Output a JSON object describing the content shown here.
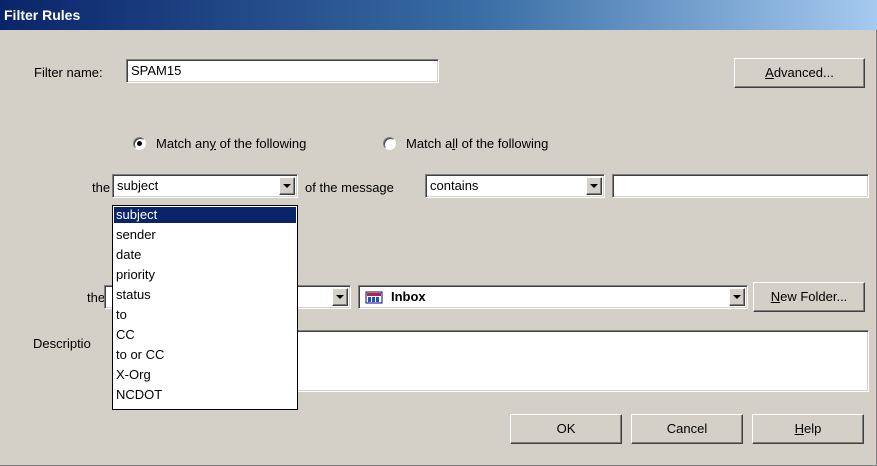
{
  "window": {
    "title": "Filter Rules"
  },
  "filter_name": {
    "label": "Filter name:",
    "value": "SPAM15"
  },
  "advanced_button": {
    "prefix": "",
    "accel": "A",
    "rest": "dvanced..."
  },
  "match": {
    "any_pre": "Match an",
    "any_accel": "y",
    "any_post": " of the following",
    "all_pre": "Match a",
    "all_accel": "l",
    "all_post": "l of the following",
    "selected": "any"
  },
  "condition": {
    "the_label": "the",
    "field_value": "subject",
    "of_message_label": "of the message",
    "operator_value": "contains",
    "text_value": ""
  },
  "field_options": [
    "subject",
    "sender",
    "date",
    "priority",
    "status",
    "to",
    "CC",
    "to or CC",
    "X-Org",
    "NCDOT"
  ],
  "action": {
    "the_label": "the",
    "folder_value": "Inbox",
    "new_folder": {
      "accel": "N",
      "rest": "ew Folder..."
    }
  },
  "description": {
    "label": "Descriptio",
    "value": ""
  },
  "buttons": {
    "ok": "OK",
    "cancel": "Cancel",
    "help_accel": "H",
    "help_rest": "elp"
  }
}
